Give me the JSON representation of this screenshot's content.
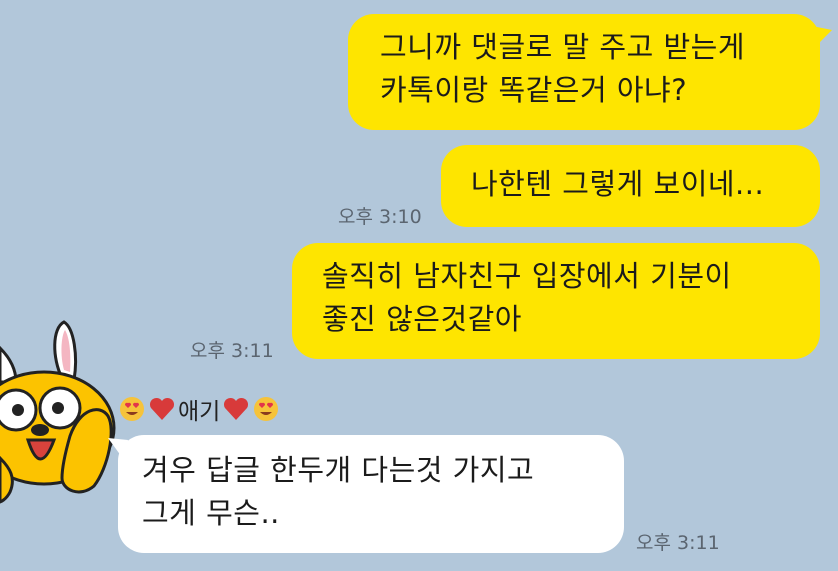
{
  "messages": [
    {
      "side": "me",
      "lines": [
        "그니까 댓글로 말 주고 받는게",
        "카톡이랑 똑같은거 아냐?"
      ],
      "time": ""
    },
    {
      "side": "me",
      "lines": [
        "나한텐 그렇게 보이네..."
      ],
      "time": "오후 3:10"
    },
    {
      "side": "me",
      "lines": [
        "솔직히 남자친구 입장에서 기분이",
        "좋진 않은것같아"
      ],
      "time": "오후 3:11"
    },
    {
      "side": "other",
      "lines": [
        "겨우 답글 한두개 다는것 가지고",
        "그게 무슨.."
      ],
      "time": "오후 3:11"
    }
  ],
  "sender": {
    "name": "애기"
  },
  "colors": {
    "background": "#b2c7da",
    "my_bubble": "#fee500",
    "other_bubble": "#ffffff"
  }
}
